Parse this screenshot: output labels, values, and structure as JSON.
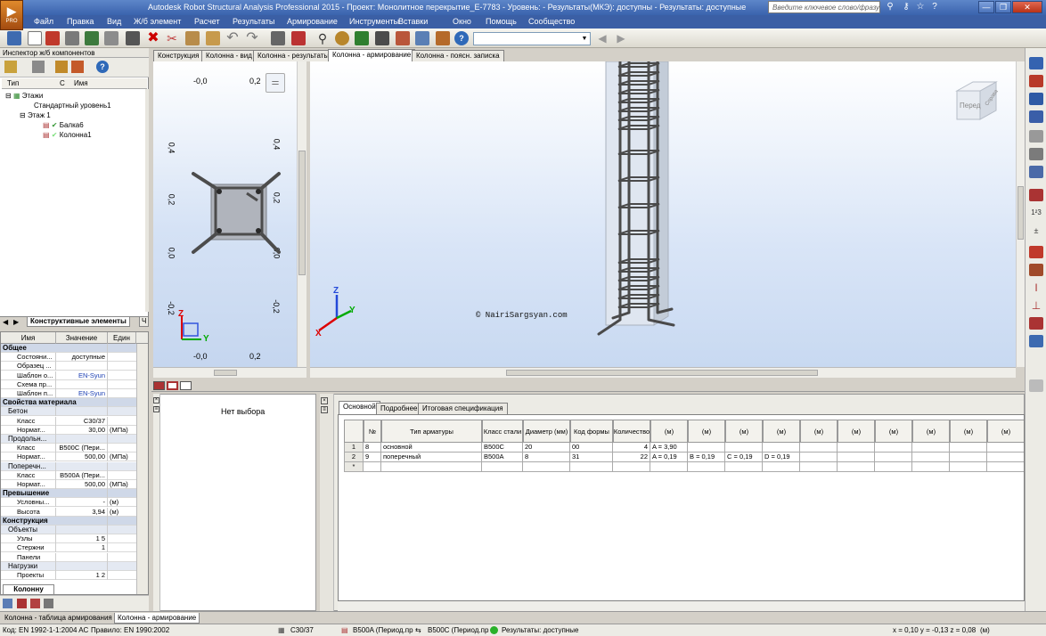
{
  "window": {
    "title": "Autodesk Robot Structural Analysis Professional 2015 - Проект: Монолитное перекрытие_E-7783 - Уровень:  - Результаты(МКЭ): доступны - Результаты: доступные",
    "logo_text": "PRO",
    "help_placeholder": "Введите ключевое слово/фразу"
  },
  "menu": [
    "Файл",
    "Правка",
    "Вид",
    "Ж/б элемент",
    "Расчет",
    "Результаты",
    "Армирование",
    "Инструменты",
    "Вставки",
    "Окно",
    "Помощь",
    "Сообщество"
  ],
  "inspector": {
    "title": "Инспектор ж/б компонентов",
    "col_type": "Тип",
    "col_c": "С",
    "col_name": "Имя",
    "tree": {
      "root": "Этажи",
      "standard_level": "Стандартный уровень1",
      "floor": "Этаж 1",
      "beam": "Балка6",
      "column": "Колонна1"
    },
    "bottom_tab": "Конструктивные элементы",
    "bottom_tab2": "Ч"
  },
  "properties": {
    "col_name": "Имя",
    "col_value": "Значение",
    "col_unit": "Един",
    "rows": [
      {
        "n": "Общее",
        "v": "",
        "u": ""
      },
      {
        "n": "Состояни...",
        "v": "доступные",
        "u": ""
      },
      {
        "n": "Образец ...",
        "v": "",
        "u": ""
      },
      {
        "n": "Шаблон о...",
        "v": "EN-Syun",
        "u": ""
      },
      {
        "n": "Схема пр...",
        "v": "",
        "u": ""
      },
      {
        "n": "Шаблон п...",
        "v": "EN-Syun",
        "u": ""
      },
      {
        "n": "Свойства материала",
        "v": "",
        "u": ""
      },
      {
        "n": "Бетон",
        "v": "",
        "u": ""
      },
      {
        "n": "Класс",
        "v": "C30/37",
        "u": ""
      },
      {
        "n": "Нормат...",
        "v": "30,00",
        "u": "(МПа)"
      },
      {
        "n": "Продольн...",
        "v": "",
        "u": ""
      },
      {
        "n": "Класс",
        "v": "B500C (Пери...",
        "u": ""
      },
      {
        "n": "Нормат...",
        "v": "500,00",
        "u": "(МПа)"
      },
      {
        "n": "Поперечн...",
        "v": "",
        "u": ""
      },
      {
        "n": "Класс",
        "v": "B500A (Пери...",
        "u": ""
      },
      {
        "n": "Нормат...",
        "v": "500,00",
        "u": "(МПа)"
      },
      {
        "n": "Превышение",
        "v": "",
        "u": ""
      },
      {
        "n": "Условны...",
        "v": "-",
        "u": "(м)"
      },
      {
        "n": "Высота",
        "v": "3,94",
        "u": "(м)"
      },
      {
        "n": "Конструкция",
        "v": "",
        "u": ""
      },
      {
        "n": "Объекты",
        "v": "",
        "u": ""
      },
      {
        "n": "Узлы",
        "v": "1 5",
        "u": ""
      },
      {
        "n": "Стержни",
        "v": "1",
        "u": ""
      },
      {
        "n": "Панели",
        "v": "",
        "u": ""
      },
      {
        "n": "Нагрузки",
        "v": "",
        "u": ""
      },
      {
        "n": "Проекты",
        "v": "1 2",
        "u": ""
      }
    ],
    "tab": "Колонну"
  },
  "view_tabs": [
    "Конструкция",
    "Колонна - вид",
    "Колонна - результаты",
    "Колонна - армирование",
    "Колонна - поясн. записка"
  ],
  "section_view": {
    "top_left": "-0,0",
    "top_right": "0,2",
    "bottom_left": "-0,0",
    "bottom_right": "0,2",
    "left_labels": [
      "0,4",
      "0,2",
      "0,0",
      "-0,2"
    ],
    "right_labels": [
      "0,4",
      "0,2",
      "0,0",
      "-0,2"
    ],
    "axis_z": "Z",
    "axis_y": "Y"
  },
  "model_view": {
    "watermark": "©  NairiSargsyan.com",
    "cube_front": "Перед",
    "cube_right": "Справа",
    "axis_x": "X",
    "axis_y": "Y",
    "axis_z": "Z"
  },
  "left_lower": {
    "no_selection": "Нет выбора"
  },
  "table_tabs": [
    "Основной",
    "Подробнее",
    "Итоговая спецификация"
  ],
  "table": {
    "headers": [
      "№",
      "Тип арматуры",
      "Класс стали",
      "Диаметр (мм)",
      "Код формы",
      "Количество",
      "(м)",
      "(м)",
      "(м)",
      "(м)",
      "(м)",
      "(м)",
      "(м)",
      "(м)",
      "(м)",
      "(м)"
    ],
    "rows": [
      {
        "rn": "1",
        "no": "8",
        "type": "основной",
        "cls": "B500C",
        "dia": "20",
        "code": "00",
        "qty": "4",
        "a": "A = 3,90",
        "b": "",
        "c": "",
        "d": ""
      },
      {
        "rn": "2",
        "no": "9",
        "type": "поперечный",
        "cls": "B500A",
        "dia": "8",
        "code": "31",
        "qty": "22",
        "a": "A = 0,19",
        "b": "B = 0,19",
        "c": "C = 0,19",
        "d": "D = 0,19"
      },
      {
        "rn": "*",
        "no": "",
        "type": "",
        "cls": "",
        "dia": "",
        "code": "",
        "qty": "",
        "a": "",
        "b": "",
        "c": "",
        "d": ""
      }
    ]
  },
  "doc_tabs": [
    "Колонна - таблица армирования",
    "Колонна - армирование"
  ],
  "status": {
    "code": "Код: EN 1992-1-1:2004 AC",
    "rule": "Правило: EN 1990:2002",
    "concrete": "C30/37",
    "trans_steel": "B500A (Период.пр",
    "long_steel": "B500C (Период.пр",
    "results": "Результаты: доступные",
    "coords": "x = 0,10  y = -0,13  z = 0,08",
    "units": "(м)"
  },
  "colors": {
    "titlebar": "#3a63ad",
    "menubar": "#3b5fa5",
    "selection": "#316ac5",
    "status_ok": "#2ab12a"
  }
}
